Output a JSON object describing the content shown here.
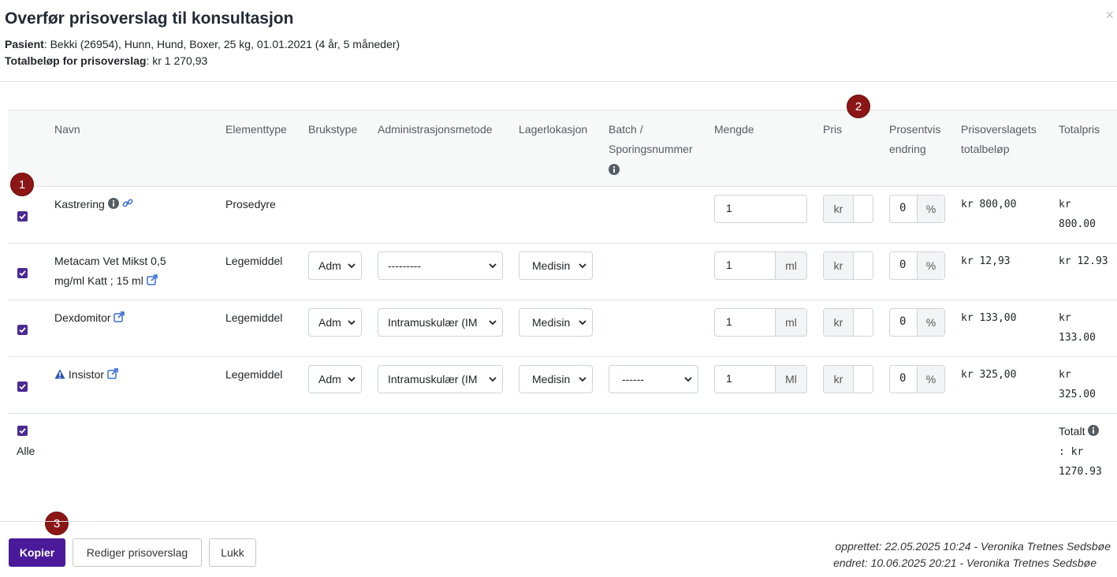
{
  "title": "Overfør prisoverslag til konsultasjon",
  "close_label": "×",
  "patient": {
    "label": "Pasient",
    "value": ": Bekki (26954), Hunn, Hund, Boxer, 25 kg, 01.01.2021 (4 år, 5 måneder)"
  },
  "total": {
    "label": "Totalbeløp for prisoverslag",
    "value": ": kr 1 270,93"
  },
  "columns": {
    "navn": "Navn",
    "elementtype": "Elementtype",
    "brukstype": "Brukstype",
    "administrasjonsmetode": "Administrasjonsmetode",
    "lagerlokasjon": "Lagerlokasjon",
    "batch_1": "Batch /",
    "batch_2": "Sporingsnummer",
    "mengde": "Mengde",
    "pris": "Pris",
    "prosent_1": "Prosentvis",
    "prosent_2": "endring",
    "prisoverslag_1": "Prisoverslagets",
    "prisoverslag_2": "totalbeløp",
    "totalpris": "Totalpris"
  },
  "rows": [
    {
      "name": "Kastrering",
      "type": "Prosedyre",
      "qty": "1",
      "unit": "",
      "kr": "kr",
      "pct": "0",
      "pct_sym": "%",
      "est": "kr 800,00",
      "total_1": "kr",
      "total_2": "800.00"
    },
    {
      "name_1": "Metacam Vet Mikst 0,5",
      "name_2": "mg/ml Katt ; 15 ml",
      "type": "Legemiddel",
      "bruk": "Adm",
      "admin": "---------",
      "lager": "Medisin",
      "qty": "1",
      "unit": "ml",
      "kr": "kr",
      "pct": "0",
      "pct_sym": "%",
      "est": "kr 12,93",
      "total": "kr 12.93"
    },
    {
      "name": "Dexdomitor",
      "type": "Legemiddel",
      "bruk": "Adm",
      "admin": "Intramuskulær (IM",
      "lager": "Medisin",
      "qty": "1",
      "unit": "ml",
      "kr": "kr",
      "pct": "0",
      "pct_sym": "%",
      "est": "kr 133,00",
      "total_1": "kr",
      "total_2": "133.00"
    },
    {
      "name": "Insistor",
      "type": "Legemiddel",
      "bruk": "Adm",
      "admin": "Intramuskulær (IM",
      "lager": "Medisin",
      "batch": "------",
      "qty": "1",
      "unit": "Ml",
      "kr": "kr",
      "pct": "0",
      "pct_sym": "%",
      "est": "kr 325,00",
      "total_1": "kr",
      "total_2": "325.00"
    }
  ],
  "all_label": "Alle",
  "grand_total": {
    "label": "Totalt",
    "line_2": ": kr",
    "line_3": "1270.93"
  },
  "badges": [
    "1",
    "2",
    "3"
  ],
  "buttons": {
    "copy": "Kopier",
    "edit": "Rediger prisoverslag",
    "close": "Lukk"
  },
  "meta": {
    "created": "opprettet: 22.05.2025 10:24 - Veronika Tretnes Sedsbøe",
    "changed": "endret: 10.06.2025 20:21 - Veronika Tretnes Sedsbøe"
  },
  "colors": {
    "primary": "#4a1a9a",
    "checkbox": "#4b2a92",
    "badge": "#8c1616",
    "link": "#3b6fd0"
  }
}
